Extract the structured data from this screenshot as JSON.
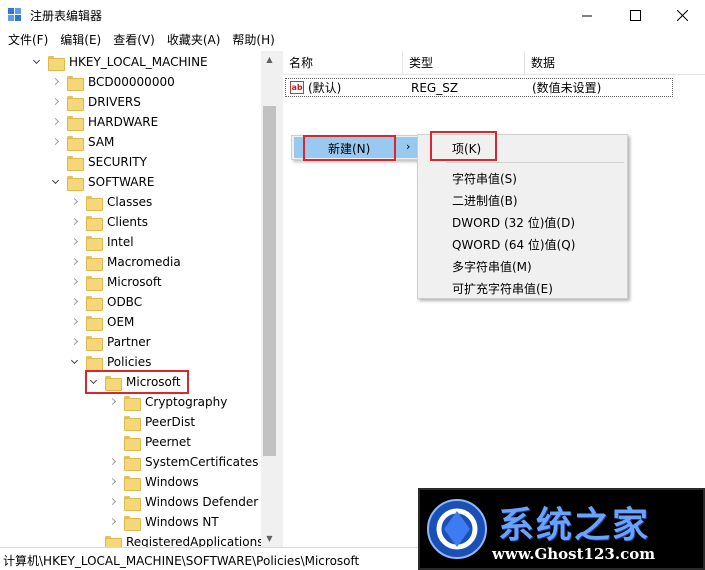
{
  "window": {
    "title": "注册表编辑器"
  },
  "menu": [
    "文件(F)",
    "编辑(E)",
    "查看(V)",
    "收藏夹(A)",
    "帮助(H)"
  ],
  "tree": [
    {
      "label": "HKEY_LOCAL_MACHINE",
      "expander": "down"
    },
    {
      "label": "BCD00000000",
      "expander": "right"
    },
    {
      "label": "DRIVERS",
      "expander": "right"
    },
    {
      "label": "HARDWARE",
      "expander": "right"
    },
    {
      "label": "SAM",
      "expander": "right"
    },
    {
      "label": "SECURITY",
      "expander": "none"
    },
    {
      "label": "SOFTWARE",
      "expander": "down"
    },
    {
      "label": "Classes",
      "expander": "right"
    },
    {
      "label": "Clients",
      "expander": "right"
    },
    {
      "label": "Intel",
      "expander": "right"
    },
    {
      "label": "Macromedia",
      "expander": "right"
    },
    {
      "label": "Microsoft",
      "expander": "right"
    },
    {
      "label": "ODBC",
      "expander": "right"
    },
    {
      "label": "OEM",
      "expander": "right"
    },
    {
      "label": "Partner",
      "expander": "right"
    },
    {
      "label": "Policies",
      "expander": "down"
    },
    {
      "label": "Microsoft",
      "expander": "down",
      "selected": true
    },
    {
      "label": "Cryptography",
      "expander": "right"
    },
    {
      "label": "PeerDist",
      "expander": "none"
    },
    {
      "label": "Peernet",
      "expander": "none"
    },
    {
      "label": "SystemCertificates",
      "expander": "right"
    },
    {
      "label": "Windows",
      "expander": "right"
    },
    {
      "label": "Windows Defender",
      "expander": "right"
    },
    {
      "label": "Windows NT",
      "expander": "right"
    },
    {
      "label": "RegisteredApplications",
      "expander": "none"
    }
  ],
  "list": {
    "columns": [
      "名称",
      "类型",
      "数据"
    ],
    "rows": [
      {
        "name": "(默认)",
        "type": "REG_SZ",
        "data": "(数值未设置)"
      }
    ]
  },
  "context_menu": {
    "new_label": "新建(N)",
    "submenu": [
      "项(K)",
      "字符串值(S)",
      "二进制值(B)",
      "DWORD (32 位)值(D)",
      "QWORD (64 位)值(Q)",
      "多字符串值(M)",
      "可扩充字符串值(E)"
    ]
  },
  "status": {
    "path": "计算机\\HKEY_LOCAL_MACHINE\\SOFTWARE\\Policies\\Microsoft"
  },
  "watermark": {
    "title": "系统之家",
    "url": "www.Ghost123.com"
  },
  "colors": {
    "highlight": "#99c9ef",
    "annotation_red": "#d9272d",
    "folder": "#f5d77a"
  }
}
